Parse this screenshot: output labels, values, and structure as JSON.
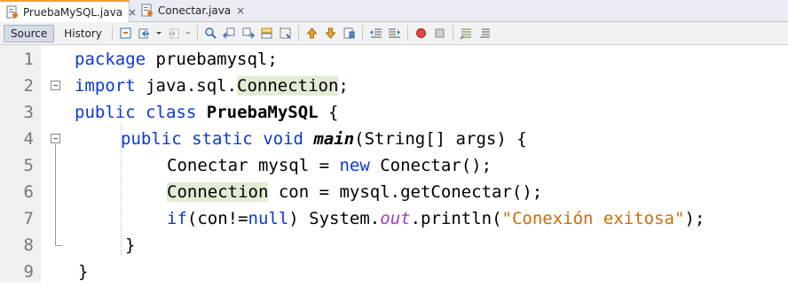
{
  "tabs": [
    {
      "label": "PruebaMySQL.java",
      "active": true,
      "icon": "java-file-icon",
      "close": "×"
    },
    {
      "label": "Conectar.java",
      "active": false,
      "icon": "java-file-icon",
      "close": "×"
    }
  ],
  "toolbar": {
    "source_label": "Source",
    "history_label": "History",
    "icons": [
      "last-edit-icon",
      "back-icon",
      "forward-icon",
      "find-icon",
      "find-previous-icon",
      "find-next-icon",
      "find-selection-icon",
      "toggle-highlight-icon",
      "toggle-rectangular-selection-icon",
      "previous-bookmark-icon",
      "next-bookmark-icon",
      "toggle-bookmark-icon",
      "shift-left-icon",
      "shift-right-icon",
      "start-macro-icon",
      "stop-macro-icon",
      "comment-icon",
      "uncomment-icon"
    ]
  },
  "editor": {
    "line_numbers": [
      "1",
      "2",
      "3",
      "4",
      "5",
      "6",
      "7",
      "8",
      "9"
    ],
    "lines": {
      "l1": {
        "kw": "package",
        "rest": " pruebamysql;"
      },
      "l2": {
        "kw": "import",
        "pre": " java.sql.",
        "hl": "Connection",
        "post": ";"
      },
      "l3": {
        "kw1": "public",
        "kw2": "class",
        "cls": "PruebaMySQL",
        "post": " {"
      },
      "l4": {
        "kw1": "public",
        "kw2": "static",
        "kw3": "void",
        "method": "main",
        "post": "(String[] args) {"
      },
      "l5": {
        "pre": "Conectar mysql = ",
        "kw": "new",
        "post": " Conectar();"
      },
      "l6": {
        "hl": "Connection",
        "post": " con = mysql.getConectar();"
      },
      "l7": {
        "kw1": "if",
        "mid1": "(con!=",
        "kw2": "null",
        "mid2": ") System.",
        "field": "out",
        "mid3": ".println(",
        "str": "\"Conexión exitosa\"",
        "post": ");"
      },
      "l8": {
        "text": "}"
      },
      "l9": {
        "text": "}"
      }
    }
  }
}
